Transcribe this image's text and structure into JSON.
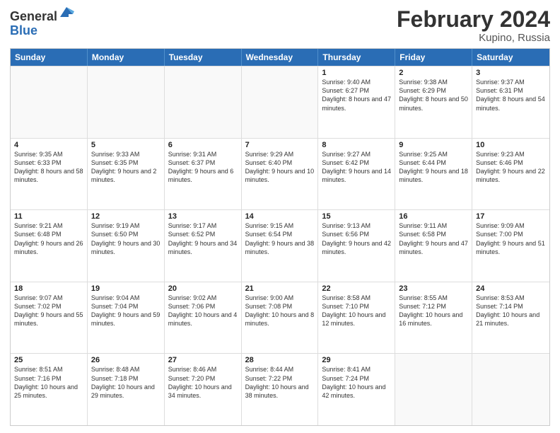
{
  "logo": {
    "general": "General",
    "blue": "Blue"
  },
  "title": "February 2024",
  "subtitle": "Kupino, Russia",
  "days": [
    "Sunday",
    "Monday",
    "Tuesday",
    "Wednesday",
    "Thursday",
    "Friday",
    "Saturday"
  ],
  "rows": [
    [
      {
        "day": "",
        "text": ""
      },
      {
        "day": "",
        "text": ""
      },
      {
        "day": "",
        "text": ""
      },
      {
        "day": "",
        "text": ""
      },
      {
        "day": "1",
        "text": "Sunrise: 9:40 AM\nSunset: 6:27 PM\nDaylight: 8 hours and 47 minutes."
      },
      {
        "day": "2",
        "text": "Sunrise: 9:38 AM\nSunset: 6:29 PM\nDaylight: 8 hours and 50 minutes."
      },
      {
        "day": "3",
        "text": "Sunrise: 9:37 AM\nSunset: 6:31 PM\nDaylight: 8 hours and 54 minutes."
      }
    ],
    [
      {
        "day": "4",
        "text": "Sunrise: 9:35 AM\nSunset: 6:33 PM\nDaylight: 8 hours and 58 minutes."
      },
      {
        "day": "5",
        "text": "Sunrise: 9:33 AM\nSunset: 6:35 PM\nDaylight: 9 hours and 2 minutes."
      },
      {
        "day": "6",
        "text": "Sunrise: 9:31 AM\nSunset: 6:37 PM\nDaylight: 9 hours and 6 minutes."
      },
      {
        "day": "7",
        "text": "Sunrise: 9:29 AM\nSunset: 6:40 PM\nDaylight: 9 hours and 10 minutes."
      },
      {
        "day": "8",
        "text": "Sunrise: 9:27 AM\nSunset: 6:42 PM\nDaylight: 9 hours and 14 minutes."
      },
      {
        "day": "9",
        "text": "Sunrise: 9:25 AM\nSunset: 6:44 PM\nDaylight: 9 hours and 18 minutes."
      },
      {
        "day": "10",
        "text": "Sunrise: 9:23 AM\nSunset: 6:46 PM\nDaylight: 9 hours and 22 minutes."
      }
    ],
    [
      {
        "day": "11",
        "text": "Sunrise: 9:21 AM\nSunset: 6:48 PM\nDaylight: 9 hours and 26 minutes."
      },
      {
        "day": "12",
        "text": "Sunrise: 9:19 AM\nSunset: 6:50 PM\nDaylight: 9 hours and 30 minutes."
      },
      {
        "day": "13",
        "text": "Sunrise: 9:17 AM\nSunset: 6:52 PM\nDaylight: 9 hours and 34 minutes."
      },
      {
        "day": "14",
        "text": "Sunrise: 9:15 AM\nSunset: 6:54 PM\nDaylight: 9 hours and 38 minutes."
      },
      {
        "day": "15",
        "text": "Sunrise: 9:13 AM\nSunset: 6:56 PM\nDaylight: 9 hours and 42 minutes."
      },
      {
        "day": "16",
        "text": "Sunrise: 9:11 AM\nSunset: 6:58 PM\nDaylight: 9 hours and 47 minutes."
      },
      {
        "day": "17",
        "text": "Sunrise: 9:09 AM\nSunset: 7:00 PM\nDaylight: 9 hours and 51 minutes."
      }
    ],
    [
      {
        "day": "18",
        "text": "Sunrise: 9:07 AM\nSunset: 7:02 PM\nDaylight: 9 hours and 55 minutes."
      },
      {
        "day": "19",
        "text": "Sunrise: 9:04 AM\nSunset: 7:04 PM\nDaylight: 9 hours and 59 minutes."
      },
      {
        "day": "20",
        "text": "Sunrise: 9:02 AM\nSunset: 7:06 PM\nDaylight: 10 hours and 4 minutes."
      },
      {
        "day": "21",
        "text": "Sunrise: 9:00 AM\nSunset: 7:08 PM\nDaylight: 10 hours and 8 minutes."
      },
      {
        "day": "22",
        "text": "Sunrise: 8:58 AM\nSunset: 7:10 PM\nDaylight: 10 hours and 12 minutes."
      },
      {
        "day": "23",
        "text": "Sunrise: 8:55 AM\nSunset: 7:12 PM\nDaylight: 10 hours and 16 minutes."
      },
      {
        "day": "24",
        "text": "Sunrise: 8:53 AM\nSunset: 7:14 PM\nDaylight: 10 hours and 21 minutes."
      }
    ],
    [
      {
        "day": "25",
        "text": "Sunrise: 8:51 AM\nSunset: 7:16 PM\nDaylight: 10 hours and 25 minutes."
      },
      {
        "day": "26",
        "text": "Sunrise: 8:48 AM\nSunset: 7:18 PM\nDaylight: 10 hours and 29 minutes."
      },
      {
        "day": "27",
        "text": "Sunrise: 8:46 AM\nSunset: 7:20 PM\nDaylight: 10 hours and 34 minutes."
      },
      {
        "day": "28",
        "text": "Sunrise: 8:44 AM\nSunset: 7:22 PM\nDaylight: 10 hours and 38 minutes."
      },
      {
        "day": "29",
        "text": "Sunrise: 8:41 AM\nSunset: 7:24 PM\nDaylight: 10 hours and 42 minutes."
      },
      {
        "day": "",
        "text": ""
      },
      {
        "day": "",
        "text": ""
      }
    ]
  ]
}
